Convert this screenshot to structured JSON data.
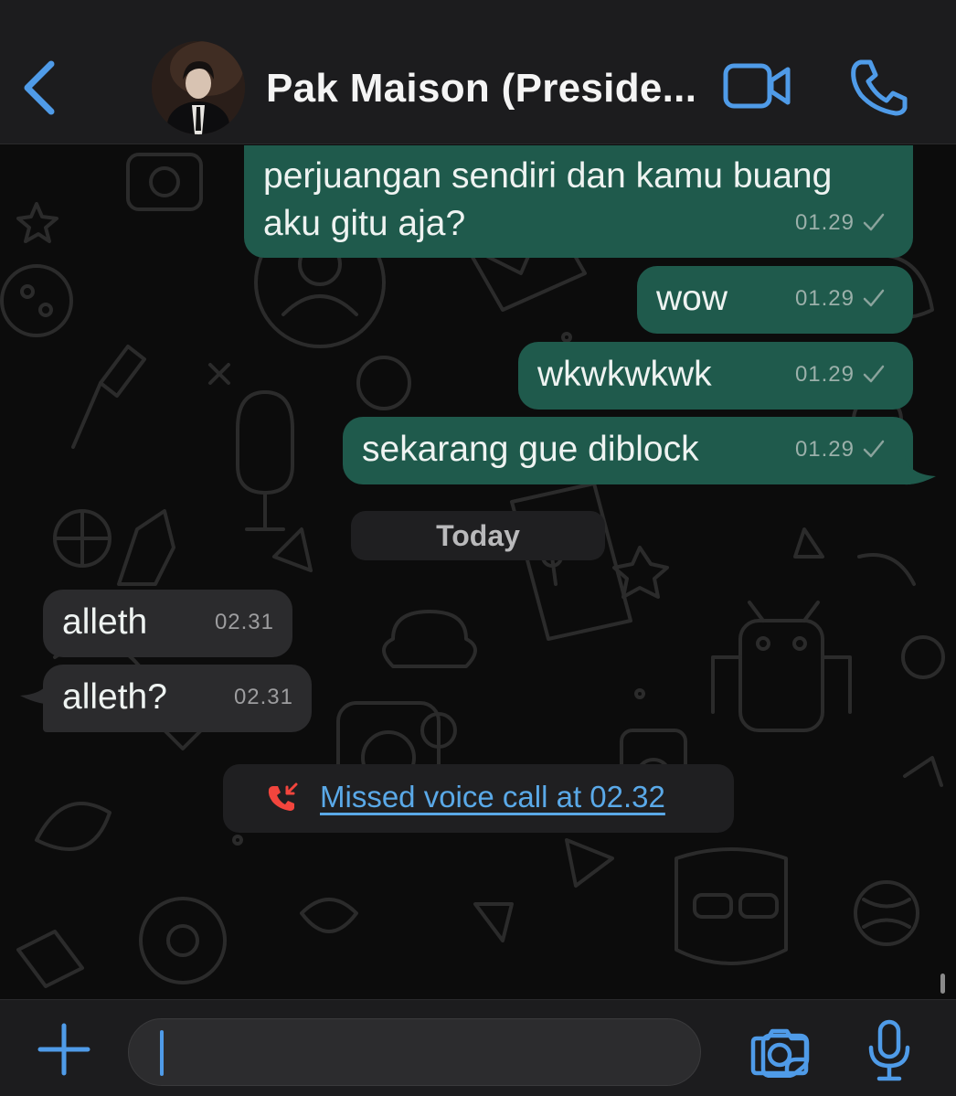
{
  "header": {
    "contact_name": "Pak Maison (Preside...",
    "back_icon": "chevron-left-icon",
    "video_icon": "video-camera-icon",
    "call_icon": "phone-icon",
    "accent_color": "#4f9be8"
  },
  "messages": [
    {
      "direction": "outgoing",
      "text_lines": [
        "perjuangan sendiri dan kamu buang",
        "aku gitu aja?"
      ],
      "time": "01.29",
      "status": "sent"
    },
    {
      "direction": "outgoing",
      "text": "wow",
      "time": "01.29",
      "status": "sent"
    },
    {
      "direction": "outgoing",
      "text": "wkwkwkwk",
      "time": "01.29",
      "status": "sent"
    },
    {
      "direction": "outgoing",
      "text": "sekarang gue diblock",
      "time": "01.29",
      "status": "sent"
    },
    {
      "direction": "incoming",
      "text": "alleth",
      "time": "02.31"
    },
    {
      "direction": "incoming",
      "text": "alleth?",
      "time": "02.31"
    }
  ],
  "day_separator": "Today",
  "missed_call": {
    "text": "Missed voice call at 02.32",
    "icon": "missed-call-icon",
    "icon_color": "#f2453d"
  },
  "composer": {
    "value": "",
    "placeholder": "",
    "attach_icon": "plus-icon",
    "sticker_icon": "sticker-icon",
    "camera_icon": "camera-icon",
    "mic_icon": "microphone-icon"
  },
  "colors": {
    "outgoing_bubble": "#1f5a4c",
    "incoming_bubble": "#2b2b2d",
    "link": "#5aa9e8"
  }
}
